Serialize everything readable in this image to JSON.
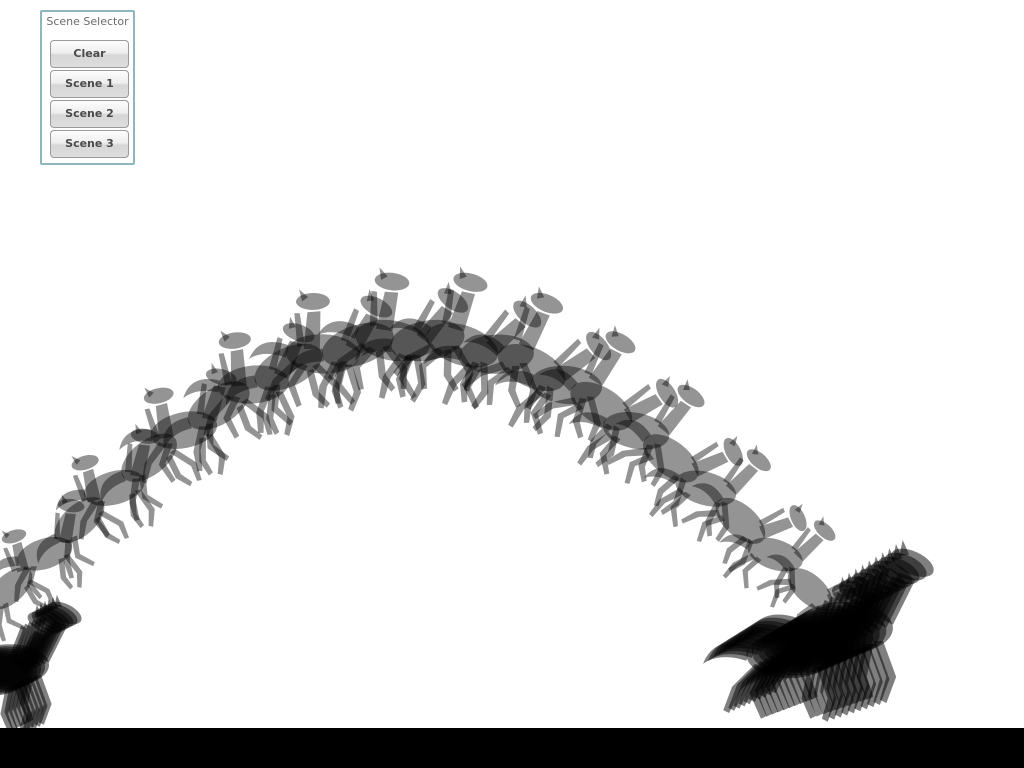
{
  "scene_selector": {
    "title": "Scene Selector",
    "buttons": [
      {
        "label": "Clear"
      },
      {
        "label": "Scene 1"
      },
      {
        "label": "Scene 2"
      },
      {
        "label": "Scene 3"
      }
    ]
  },
  "colors": {
    "panel_border": "#8fb5c0",
    "silhouette": "#000000",
    "bottom_bar": "#000000",
    "background": "#ffffff"
  },
  "scene": {
    "subject": "horse-silhouette-icon",
    "frame_count": 24
  }
}
